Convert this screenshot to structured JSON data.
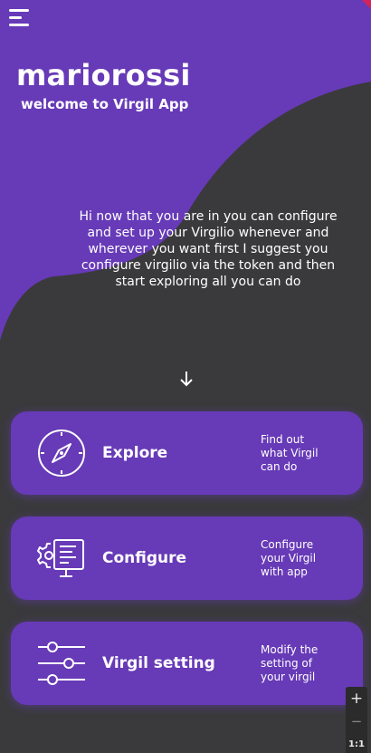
{
  "colors": {
    "purple": "#673ab7",
    "background": "#3a3a3c",
    "text": "#ffffff",
    "corner": "#d0245e"
  },
  "header": {
    "menu_icon": "hamburger-icon",
    "username": "mariorossi",
    "welcome": "welcome to Virgil App"
  },
  "intro": {
    "text": "Hi now that you are in you can configure and set up your Virgilio whenever and wherever you want first I suggest you configure virgilio via the token and then start exploring all you can do"
  },
  "scroll_hint_icon": "arrow-down-icon",
  "cards": [
    {
      "title": "Explore",
      "description": "Find out\nwhat Virgil\ncan do",
      "icon": "compass-icon"
    },
    {
      "title": "Configure",
      "description": "Configure\nyour Virgil\nwith app",
      "icon": "monitor-gear-icon"
    },
    {
      "title": "Virgil setting",
      "description": "Modify the\nsetting of\nyour virgil",
      "icon": "sliders-icon"
    }
  ],
  "zoom": {
    "plus": "+",
    "minus": "−",
    "ratio": "1:1"
  }
}
